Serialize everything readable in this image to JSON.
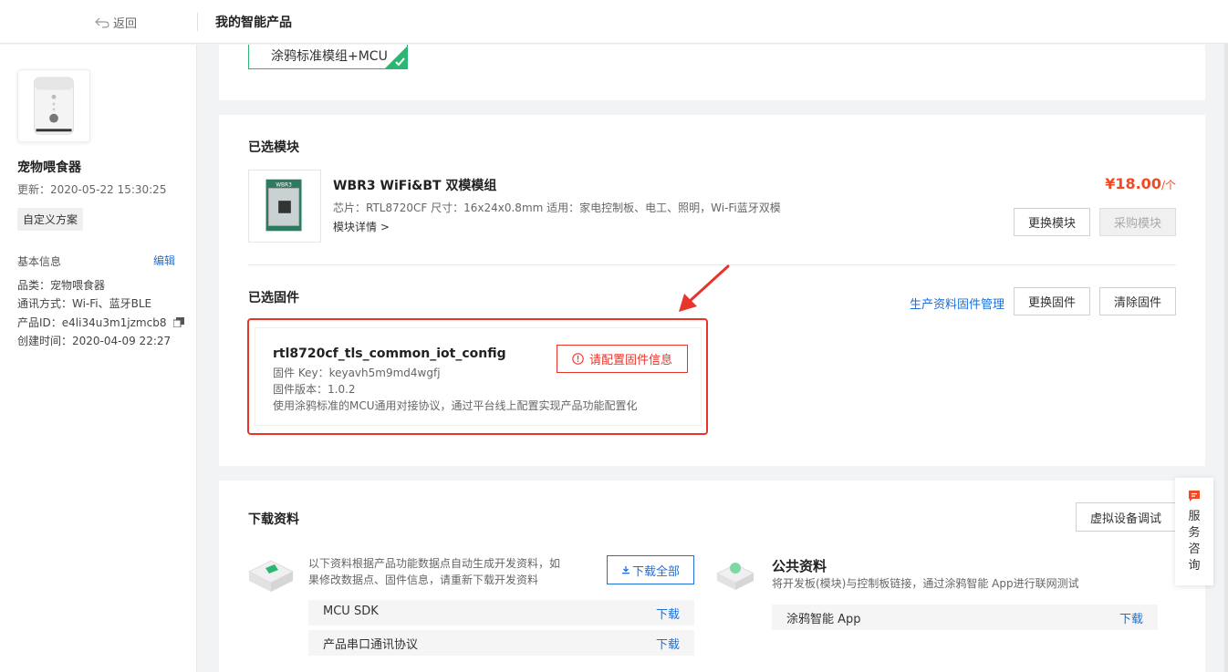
{
  "header": {
    "back_label": "返回",
    "title": "我的智能产品"
  },
  "sidebar": {
    "product_name": "宠物喂食器",
    "updated": "更新：2020-05-22 15:30:25",
    "tag": "自定义方案",
    "basic_info_label": "基本信息",
    "edit_label": "编辑",
    "category": "品类：宠物喂食器",
    "comm": "通讯方式：Wi-Fi、蓝牙BLE",
    "product_id": "产品ID：e4li34u3m1jzmcb8",
    "created": "创建时间：2020-04-09 22:27"
  },
  "solution_chip": {
    "label": "涂鸦标准模组+MCU"
  },
  "selected_module": {
    "section_title": "已选模块",
    "name": "WBR3 WiFi&BT 双模模组",
    "spec": "芯片：RTL8720CF   尺寸：16x24x0.8mm   适用：家电控制板、电工、照明，Wi-Fi蓝牙双模",
    "detail_link": "模块详情 >",
    "price": "¥18.00",
    "price_unit": "/个",
    "change_button": "更换模块",
    "buy_button": "采购模块"
  },
  "selected_firmware": {
    "section_title": "已选固件",
    "manage_link": "生产资料固件管理",
    "change_button": "更换固件",
    "clear_button": "清除固件",
    "name": "rtl8720cf_tls_common_iot_config",
    "key": "固件 Key：keyavh5m9md4wgfj",
    "version": "固件版本：1.0.2",
    "description": "使用涂鸦标准的MCU通用对接协议，通过平台线上配置实现产品功能配置化",
    "config_button": "请配置固件信息"
  },
  "downloads": {
    "section_title": "下载资料",
    "virtual_debug_button": "虚拟设备调试",
    "description": "以下资料根据产品功能数据点自动生成开发资料，如果修改数据点、固件信息，请重新下载开发资料",
    "download_all_button": "下载全部",
    "items": [
      {
        "name": "MCU SDK",
        "action": "下载"
      },
      {
        "name": "产品串口通讯协议",
        "action": "下载"
      }
    ],
    "public_title": "公共资料",
    "public_desc": "将开发板(模块)与控制板链接，通过涂鸦智能 App进行联网测试",
    "public_items": [
      {
        "name": "涂鸦智能 App",
        "action": "下载"
      }
    ]
  },
  "service_float": {
    "label": "服务咨询"
  },
  "colors": {
    "accent": "#1e6fd9",
    "danger": "#e8352c",
    "success": "#2bb673",
    "price": "#f04a24"
  }
}
